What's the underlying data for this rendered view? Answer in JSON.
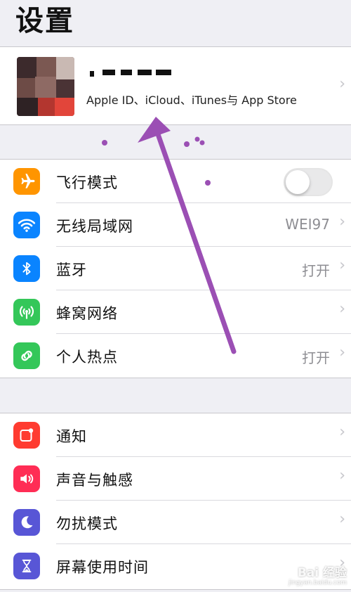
{
  "header": {
    "title": "设置"
  },
  "profile": {
    "subtitle": "Apple ID、iCloud、iTunes与 App Store",
    "chevron": "›"
  },
  "groups": [
    {
      "rows": [
        {
          "icon": "airplane-icon",
          "color": "#ff9500",
          "label": "飞行模式",
          "control": "toggle",
          "toggle_on": false
        },
        {
          "icon": "wifi-icon",
          "color": "#0a84ff",
          "label": "无线局域网",
          "value": "WEI97",
          "chevron": "›"
        },
        {
          "icon": "bluetooth-icon",
          "color": "#0a84ff",
          "label": "蓝牙",
          "value": "打开",
          "chevron": "›"
        },
        {
          "icon": "cellular-icon",
          "color": "#34c759",
          "label": "蜂窝网络",
          "chevron": "›"
        },
        {
          "icon": "hotspot-icon",
          "color": "#34c759",
          "label": "个人热点",
          "value": "打开",
          "chevron": "›"
        }
      ]
    },
    {
      "rows": [
        {
          "icon": "notifications-icon",
          "color": "#ff3b30",
          "label": "通知",
          "chevron": "›"
        },
        {
          "icon": "sound-icon",
          "color": "#ff2d55",
          "label": "声音与触感",
          "chevron": "›"
        },
        {
          "icon": "moon-icon",
          "color": "#5856d6",
          "label": "勿扰模式",
          "chevron": "›"
        },
        {
          "icon": "hourglass-icon",
          "color": "#5856d6",
          "label": "屏幕使用时间",
          "chevron": "›"
        }
      ]
    }
  ],
  "annotation": {
    "color": "#9b4fb4"
  },
  "watermark": {
    "main": "Bai 经验",
    "sub": "jingyan.baidu.com"
  }
}
